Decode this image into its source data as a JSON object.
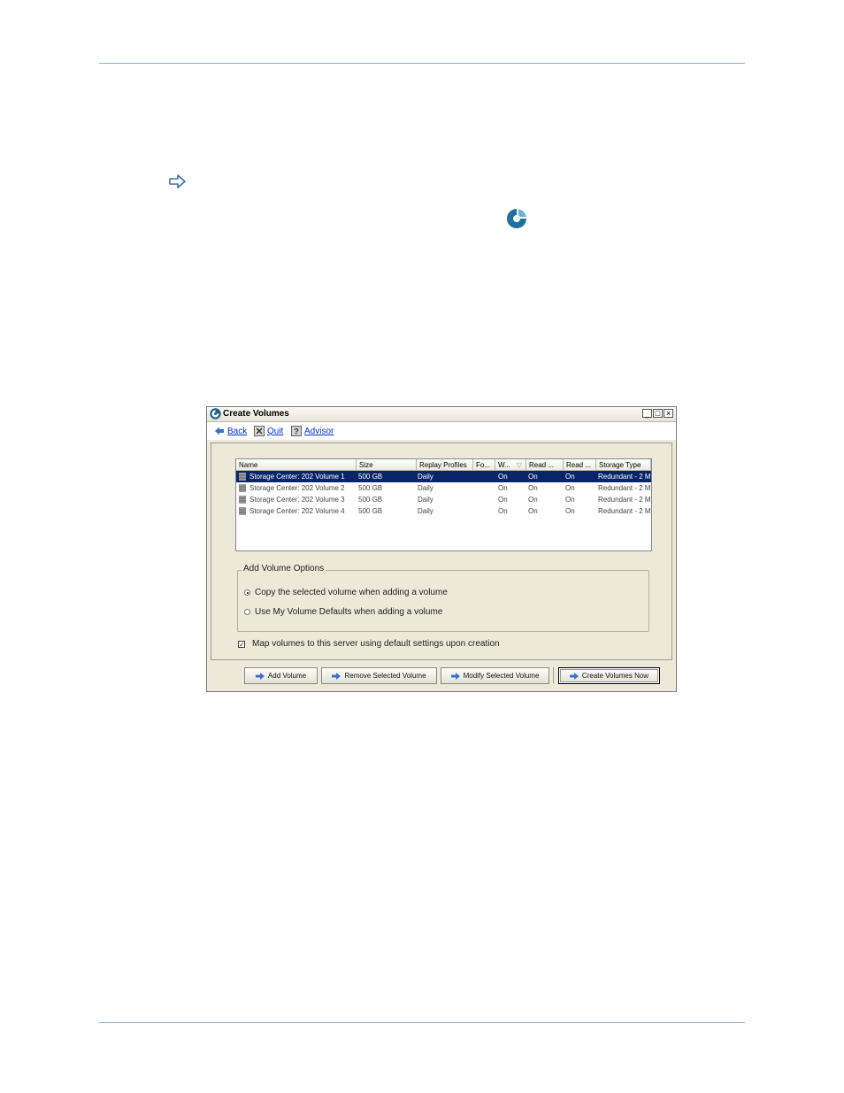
{
  "window": {
    "title": "Create Volumes",
    "controls": {
      "minimize": "_",
      "maximize": "□",
      "close": "×"
    }
  },
  "nav": {
    "back": "Back",
    "quit": "Quit",
    "advisor": "Advisor"
  },
  "table": {
    "columns": [
      "Name",
      "Size",
      "Replay Profiles",
      "Fo...",
      "W...",
      "Read ...",
      "Read ...",
      "Storage Type"
    ],
    "rows": [
      {
        "name": "Storage Center: 202 Volume 1",
        "size": "500 GB",
        "replay": "Daily",
        "fo": "",
        "w": "On",
        "read1": "On",
        "read2": "On",
        "storage": "Redundant - 2 M",
        "selected": true
      },
      {
        "name": "Storage Center: 202 Volume 2",
        "size": "500 GB",
        "replay": "Daily",
        "fo": "",
        "w": "On",
        "read1": "On",
        "read2": "On",
        "storage": "Redundant - 2 M",
        "selected": false
      },
      {
        "name": "Storage Center: 202 Volume 3",
        "size": "500 GB",
        "replay": "Daily",
        "fo": "",
        "w": "On",
        "read1": "On",
        "read2": "On",
        "storage": "Redundant - 2 M",
        "selected": false
      },
      {
        "name": "Storage Center: 202 Volume 4",
        "size": "500 GB",
        "replay": "Daily",
        "fo": "",
        "w": "On",
        "read1": "On",
        "read2": "On",
        "storage": "Redundant - 2 M",
        "selected": false
      }
    ]
  },
  "options": {
    "title": "Add Volume Options",
    "copy_selected": "Copy the selected volume when adding a volume",
    "use_defaults": "Use My Volume Defaults when adding a volume",
    "selected": "copy_selected"
  },
  "map_checkbox": {
    "label": "Map volumes to this server using default settings upon creation",
    "checked": true,
    "mark": "✓"
  },
  "buttons": {
    "add": "Add Volume",
    "remove": "Remove Selected Volume",
    "modify": "Modify Selected Volume",
    "create": "Create Volumes Now"
  },
  "colors": {
    "selection": "#0a246a",
    "rule": "#8fb0c8",
    "brand": "#1f6f9f"
  },
  "icons": [
    "arrow-right-icon",
    "compellent-logo-icon",
    "back-icon",
    "quit-icon",
    "advisor-icon",
    "volume-icon",
    "blue-arrow-icon"
  ]
}
